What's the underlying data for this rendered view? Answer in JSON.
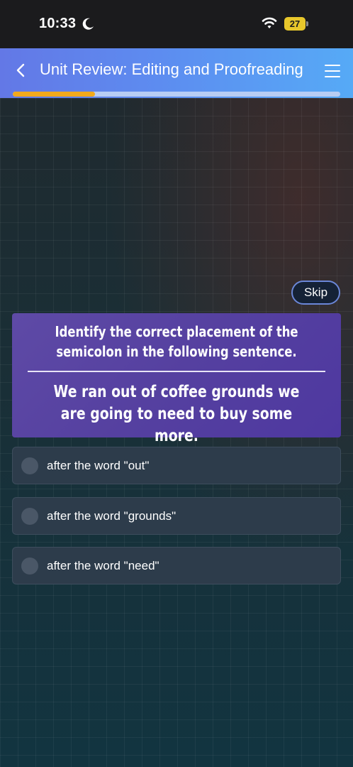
{
  "status_bar": {
    "time": "10:33",
    "battery": "27",
    "icons": [
      "moon-icon",
      "wifi-icon",
      "battery-icon"
    ]
  },
  "header": {
    "title": "Unit Review: Editing and Proofreading",
    "progress_fraction": 0.25,
    "icons": [
      "back-chevron-icon",
      "menu-icon"
    ]
  },
  "colors": {
    "header_gradient_start": "#6378e6",
    "header_gradient_end": "#56aaf6",
    "progress_fill": "#f2a91c",
    "card_purple": "#5540a0",
    "option_bg": "#2d3c4b"
  },
  "skip_label": "Skip",
  "question": {
    "prompt": "Identify the correct placement of the semicolon in the following sentence.",
    "sentence": "We ran out of coffee grounds we are going to need to buy some more."
  },
  "options": [
    {
      "label": "after the word \"out\""
    },
    {
      "label": "after the word \"grounds\""
    },
    {
      "label": "after the word \"need\""
    }
  ]
}
